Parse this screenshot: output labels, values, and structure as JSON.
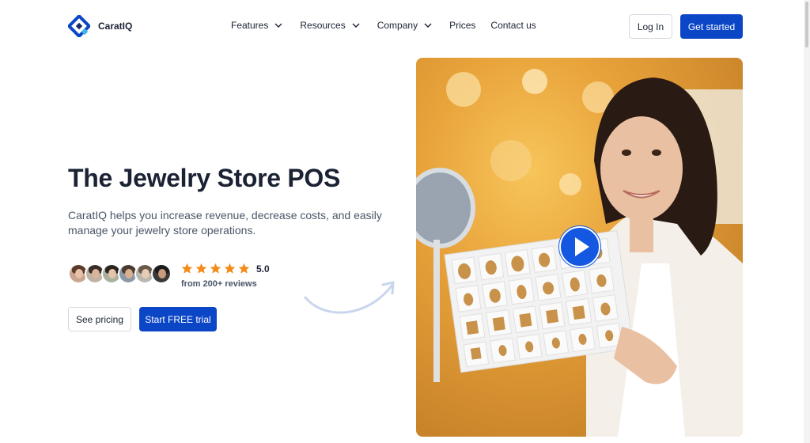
{
  "brand": {
    "name": "CaratIQ"
  },
  "nav": {
    "items": [
      {
        "label": "Features",
        "dropdown": true
      },
      {
        "label": "Resources",
        "dropdown": true
      },
      {
        "label": "Company",
        "dropdown": true
      },
      {
        "label": "Prices",
        "dropdown": false
      },
      {
        "label": "Contact us",
        "dropdown": false
      }
    ],
    "login_label": "Log In",
    "get_started_label": "Get started"
  },
  "hero": {
    "title": "The Jewelry Store POS",
    "subtitle": "CaratIQ helps you increase revenue, decrease costs, and easily manage your jewelry store operations.",
    "rating": "5.0",
    "stars": 5,
    "reviews": "from 200+ reviews",
    "pricing_label": "See pricing",
    "trial_label": "Start FREE trial",
    "media_icon": "play-icon"
  },
  "colors": {
    "primary": "#0b46c7",
    "star": "#f28c1b",
    "text": "#1a2233",
    "muted": "#4a5568"
  }
}
